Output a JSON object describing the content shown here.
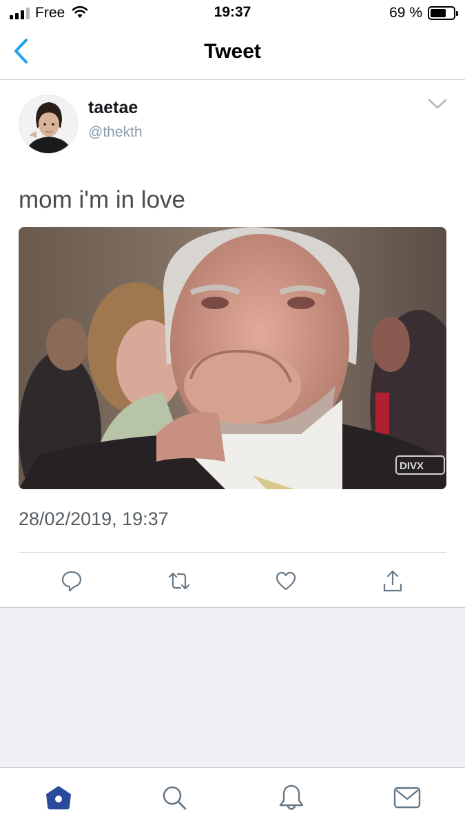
{
  "status_bar": {
    "carrier": "Free",
    "time": "19:37",
    "battery_percent": "69 %",
    "battery_level": 0.69,
    "icons": [
      "signal-icon",
      "wifi-icon",
      "battery-icon"
    ]
  },
  "nav": {
    "title": "Tweet",
    "back_icon": "chevron-left-icon"
  },
  "tweet": {
    "author": {
      "display_name": "taetae",
      "handle": "@thekth"
    },
    "text": "mom i'm in love",
    "media_watermark": "DIVX",
    "timestamp": "28/02/2019, 19:37",
    "more_icon": "chevron-down-icon",
    "actions": [
      "reply-icon",
      "retweet-icon",
      "like-icon",
      "share-icon"
    ]
  },
  "tabs": [
    "home-icon",
    "search-icon",
    "notifications-icon",
    "messages-icon"
  ],
  "colors": {
    "accent": "#1da1f2",
    "tab_active": "#2a4a9c",
    "icon_gray": "#657786",
    "background_gray": "#efeff4"
  }
}
